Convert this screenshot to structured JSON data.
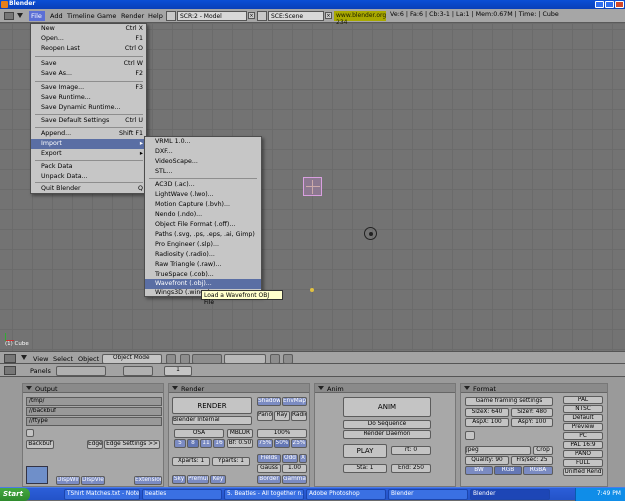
{
  "window": {
    "title": "Blender"
  },
  "header": {
    "menus": [
      "File",
      "Add",
      "Timeline",
      "Game",
      "Render",
      "Help"
    ],
    "screen_field": "SCR:2 - Model",
    "scene_field": "SCE:Scene",
    "url": "www.blender.org 234",
    "stats": "Ve:6 | Fa:6 | Cb:3-1 | La:1 | Mem:0.67M | Time: | Cube"
  },
  "file_menu": {
    "items": [
      {
        "label": "New",
        "key": "Ctrl X"
      },
      {
        "label": "Open...",
        "key": "F1"
      },
      {
        "label": "Reopen Last",
        "key": "Ctrl O"
      },
      {
        "label": "Save",
        "key": "Ctrl W"
      },
      {
        "label": "Save As...",
        "key": "F2"
      },
      {
        "label": "Save Image...",
        "key": "F3"
      },
      {
        "label": "Save Runtime...",
        "key": ""
      },
      {
        "label": "Save Dynamic Runtime...",
        "key": ""
      },
      {
        "label": "Save Default Settings",
        "key": "Ctrl U"
      },
      {
        "label": "Append...",
        "key": "Shift F1"
      },
      {
        "label": "Import",
        "key": ""
      },
      {
        "label": "Export",
        "key": ""
      },
      {
        "label": "Pack Data",
        "key": ""
      },
      {
        "label": "Unpack Data...",
        "key": ""
      },
      {
        "label": "Quit Blender",
        "key": "Q"
      }
    ]
  },
  "import_menu": {
    "items": [
      "VRML 1.0...",
      "DXF...",
      "VideoScape...",
      "STL...",
      "AC3D (.ac)...",
      "LightWave (.lwo)...",
      "Motion Capture (.bvh)...",
      "Nendo (.ndo)...",
      "Object File Format (.off)...",
      "Paths (.svg, .ps, .eps, .ai, Gimp)",
      "Pro Engineer (.slp)...",
      "Radiosity (.radio)...",
      "Raw Triangle (.raw)...",
      "TrueSpace (.cob)...",
      "Wavefront (.obj)...",
      "Wings3D (.wings)..."
    ],
    "tooltip": "Load a Wavefront OBJ File"
  },
  "viewport": {
    "label": "(1) Cube"
  },
  "vp_header": {
    "view": "View",
    "select": "Select",
    "object": "Object",
    "mode": "Object Mode"
  },
  "btn_header": {
    "panels": "Panels",
    "frame": "1"
  },
  "output_panel": {
    "title": "Output",
    "paths": [
      "/tmp/",
      "//backbuf",
      "//ftype"
    ],
    "backbuf": "Backbuf",
    "edge": "Edge",
    "edge_settings": "Edge Settings >>",
    "dispwin": "DispWin",
    "dispview": "DispView",
    "extensions": "Extension"
  },
  "render_panel": {
    "title": "Render",
    "render": "RENDER",
    "shadow": "Shadow",
    "envmap": "EnvMap",
    "engine": "Blender Internal",
    "pano": "Pano",
    "ray": "Ray",
    "radio": "Radio",
    "osa": "OSA",
    "mblur": "MBLUR",
    "osa_vals": [
      "5",
      "8",
      "11",
      "16"
    ],
    "bf": "Bf: 0.50",
    "size100": "100%",
    "sizes": [
      "75%",
      "50%",
      "25%"
    ],
    "xparts": "Xparts: 1",
    "yparts": "Yparts: 1",
    "fields": "Fields",
    "odd": "Odd",
    "x": "X",
    "gauss": "Gauss",
    "gauss_val": "1.00",
    "sky": "Sky",
    "premul": "Premul",
    "key": "Key",
    "border": "Border",
    "gamma": "Gamma"
  },
  "anim_panel": {
    "title": "Anim",
    "anim": "ANIM",
    "do_sequence": "Do Sequence",
    "render_daemon": "Render Daemon",
    "play": "PLAY",
    "rt": "rt: 0",
    "sta": "Sta: 1",
    "end": "End: 250"
  },
  "format_panel": {
    "title": "Format",
    "game": "Game framing settings",
    "sizex": "SizeX: 640",
    "sizey": "SizeY: 480",
    "aspx": "AspX: 100",
    "aspy": "AspY: 100",
    "jpeg": "Jpeg",
    "crop": "Crop",
    "quality": "Quality: 90",
    "fps": "Frs/sec: 25",
    "bw": "BW",
    "rgb": "RGB",
    "rgba": "RGBA",
    "presets": [
      "PAL",
      "NTSC",
      "Default",
      "Preview",
      "PC",
      "PAL 16:9",
      "PANO",
      "FULL",
      "Unified Rend"
    ]
  },
  "taskbar": {
    "start": "Start",
    "tasks": [
      "TShirt Matches.txt - Note...",
      "beatles",
      "5. Beatles - All together n...",
      "Adobe Photoshop",
      "Blender"
    ],
    "time": "7:49 PM"
  },
  "colors": {
    "menu_highlight": "#5a6ea4",
    "title_blue": "#0b4fd6",
    "url_bg": "#a9a900"
  }
}
